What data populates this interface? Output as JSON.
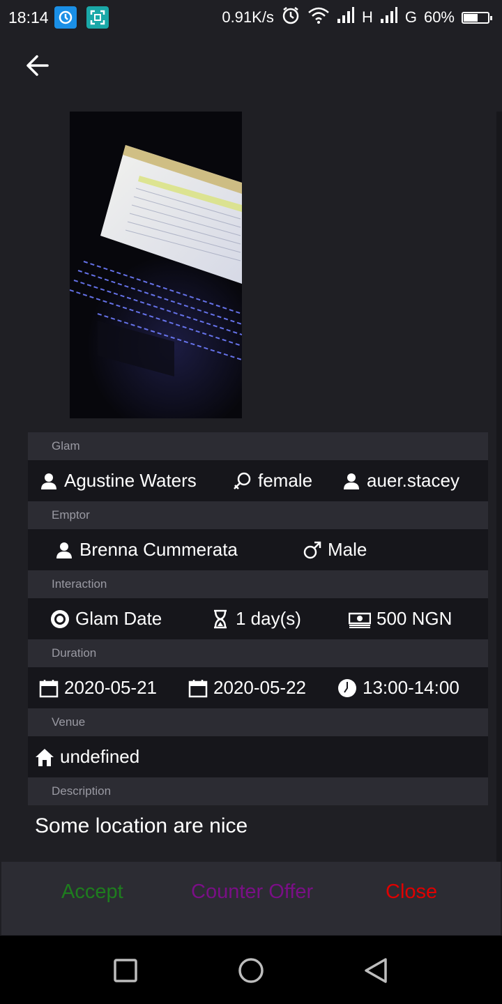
{
  "status_bar": {
    "time": "18:14",
    "speed": "0.91K/s",
    "net1": "H",
    "net2": "G",
    "battery": "60%",
    "battery_level": 0.6,
    "icons": [
      "app-sync-icon",
      "screen-capture-icon",
      "alarm-icon",
      "wifi-icon",
      "signal-icon",
      "battery-icon"
    ]
  },
  "header": {
    "back_icon": "arrow-left-icon"
  },
  "sections": {
    "glam": {
      "label": "Glam",
      "name": "Agustine Waters",
      "gender": "female",
      "username": "auer.stacey"
    },
    "emptor": {
      "label": "Emptor",
      "name": "Brenna Cummerata",
      "gender": "Male"
    },
    "interaction": {
      "label": "Interaction",
      "type": "Glam Date",
      "length": "1 day(s)",
      "price": "500 NGN"
    },
    "duration": {
      "label": "Duration",
      "start_date": "2020-05-21",
      "end_date": "2020-05-22",
      "time": "13:00-14:00"
    },
    "venue": {
      "label": "Venue",
      "value": "undefined"
    },
    "description": {
      "label": "Description",
      "value": "Some location are nice"
    }
  },
  "actions": {
    "accept": "Accept",
    "counter_offer": "Counter Offer",
    "close": "Close",
    "colors": {
      "accept": "#1e7d1e",
      "counter": "#7a0f86",
      "close": "#e00000"
    }
  },
  "nav": {
    "icons": [
      "recents-square-icon",
      "home-circle-icon",
      "back-triangle-icon"
    ]
  }
}
